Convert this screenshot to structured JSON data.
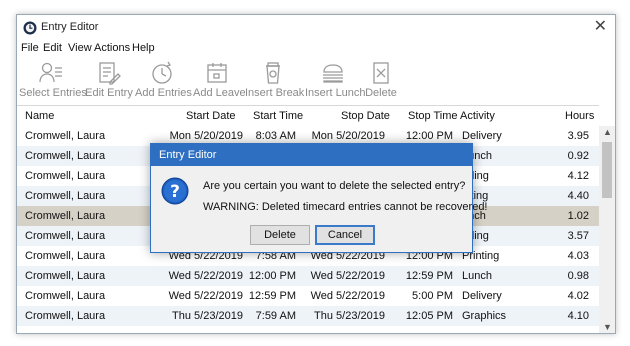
{
  "window": {
    "title": "Entry Editor",
    "close_glyph": "✕"
  },
  "menu": [
    "File",
    "Edit",
    "View",
    "Actions",
    "Help"
  ],
  "toolbar": [
    {
      "label": "Select Entries",
      "icon": "select-entries-icon"
    },
    {
      "label": "Edit Entry",
      "icon": "edit-entry-icon"
    },
    {
      "label": "Add Entries",
      "icon": "add-entries-icon"
    },
    {
      "label": "Add Leave",
      "icon": "add-leave-icon"
    },
    {
      "label": "Insert Break",
      "icon": "insert-break-icon"
    },
    {
      "label": "Insert Lunch",
      "icon": "insert-lunch-icon"
    },
    {
      "label": "Delete",
      "icon": "delete-icon"
    }
  ],
  "columns": [
    "Name",
    "Start Date",
    "Start Time",
    "Stop Date",
    "Stop Time",
    "Activity",
    "Hours"
  ],
  "rows": [
    {
      "name": "Cromwell, Laura",
      "start_date": "Mon 5/20/2019",
      "start_time": "8:03 AM",
      "stop_date": "Mon 5/20/2019",
      "stop_time": "12:00 PM",
      "activity": "Delivery",
      "hours": "3.95"
    },
    {
      "name": "Cromwell, Laura",
      "start_date": "",
      "start_time": "",
      "stop_date": "",
      "stop_time": "",
      "activity": "Lunch",
      "hours": "0.92"
    },
    {
      "name": "Cromwell, Laura",
      "start_date": "",
      "start_time": "",
      "stop_date": "",
      "stop_time": "",
      "activity": "nding",
      "hours": "4.12"
    },
    {
      "name": "Cromwell, Laura",
      "start_date": "",
      "start_time": "",
      "stop_date": "",
      "stop_time": "",
      "activity": "inting",
      "hours": "4.40"
    },
    {
      "name": "Cromwell, Laura",
      "start_date": "",
      "start_time": "",
      "stop_date": "",
      "stop_time": "",
      "activity": "unch",
      "hours": "1.02"
    },
    {
      "name": "Cromwell, Laura",
      "start_date": "",
      "start_time": "",
      "stop_date": "",
      "stop_time": "",
      "activity": "nding",
      "hours": "3.57"
    },
    {
      "name": "Cromwell, Laura",
      "start_date": "Wed 5/22/2019",
      "start_time": "7:58 AM",
      "stop_date": "Wed 5/22/2019",
      "stop_time": "12:00 PM",
      "activity": "Printing",
      "hours": "4.03"
    },
    {
      "name": "Cromwell, Laura",
      "start_date": "Wed 5/22/2019",
      "start_time": "12:00 PM",
      "stop_date": "Wed 5/22/2019",
      "stop_time": "12:59 PM",
      "activity": "Lunch",
      "hours": "0.98"
    },
    {
      "name": "Cromwell, Laura",
      "start_date": "Wed 5/22/2019",
      "start_time": "12:59 PM",
      "stop_date": "Wed 5/22/2019",
      "stop_time": "5:00 PM",
      "activity": "Delivery",
      "hours": "4.02"
    },
    {
      "name": "Cromwell, Laura",
      "start_date": "Thu 5/23/2019",
      "start_time": "7:59 AM",
      "stop_date": "Thu 5/23/2019",
      "stop_time": "12:05 PM",
      "activity": "Graphics",
      "hours": "4.10"
    }
  ],
  "selected_row": 4,
  "dialog": {
    "title": "Entry Editor",
    "message": "Are you certain you want to delete the selected entry?",
    "warning": "WARNING: Deleted timecard entries cannot be recovered!",
    "delete_label": "Delete",
    "cancel_label": "Cancel",
    "icon": "question-icon"
  },
  "colors": {
    "selected_row": "#d6d1c6",
    "alt_row": "#eef3f8",
    "dialog_title": "#2f6fc1"
  }
}
